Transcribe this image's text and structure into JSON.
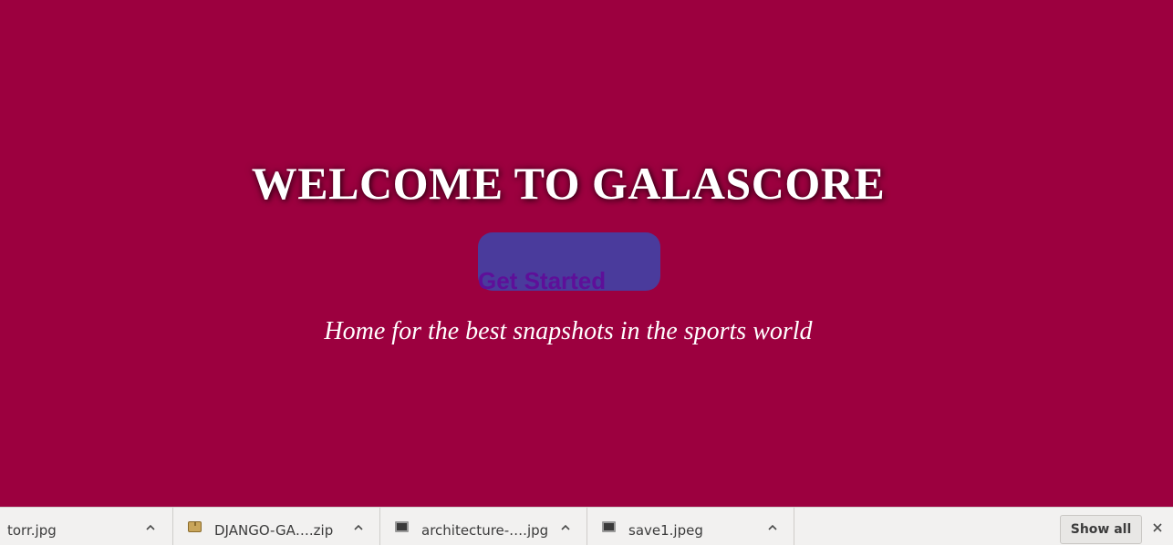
{
  "hero": {
    "title": "WELCOME TO GALASCORE",
    "cta_label": "Get Started",
    "tagline": "Home for the best snapshots in the sports world"
  },
  "download_shelf": {
    "items": [
      {
        "name": "torr.jpg",
        "icon": "none"
      },
      {
        "name": "DJANGO-GA….zip",
        "icon": "zip-icon"
      },
      {
        "name": "architecture-….jpg",
        "icon": "image-icon"
      },
      {
        "name": "save1.jpeg",
        "icon": "image-icon"
      }
    ],
    "show_all_label": "Show all"
  },
  "colors": {
    "background": "#9c003f",
    "button": "#4a3b9c",
    "button_text": "#5e0f99",
    "shelf": "#f2f1f0"
  }
}
